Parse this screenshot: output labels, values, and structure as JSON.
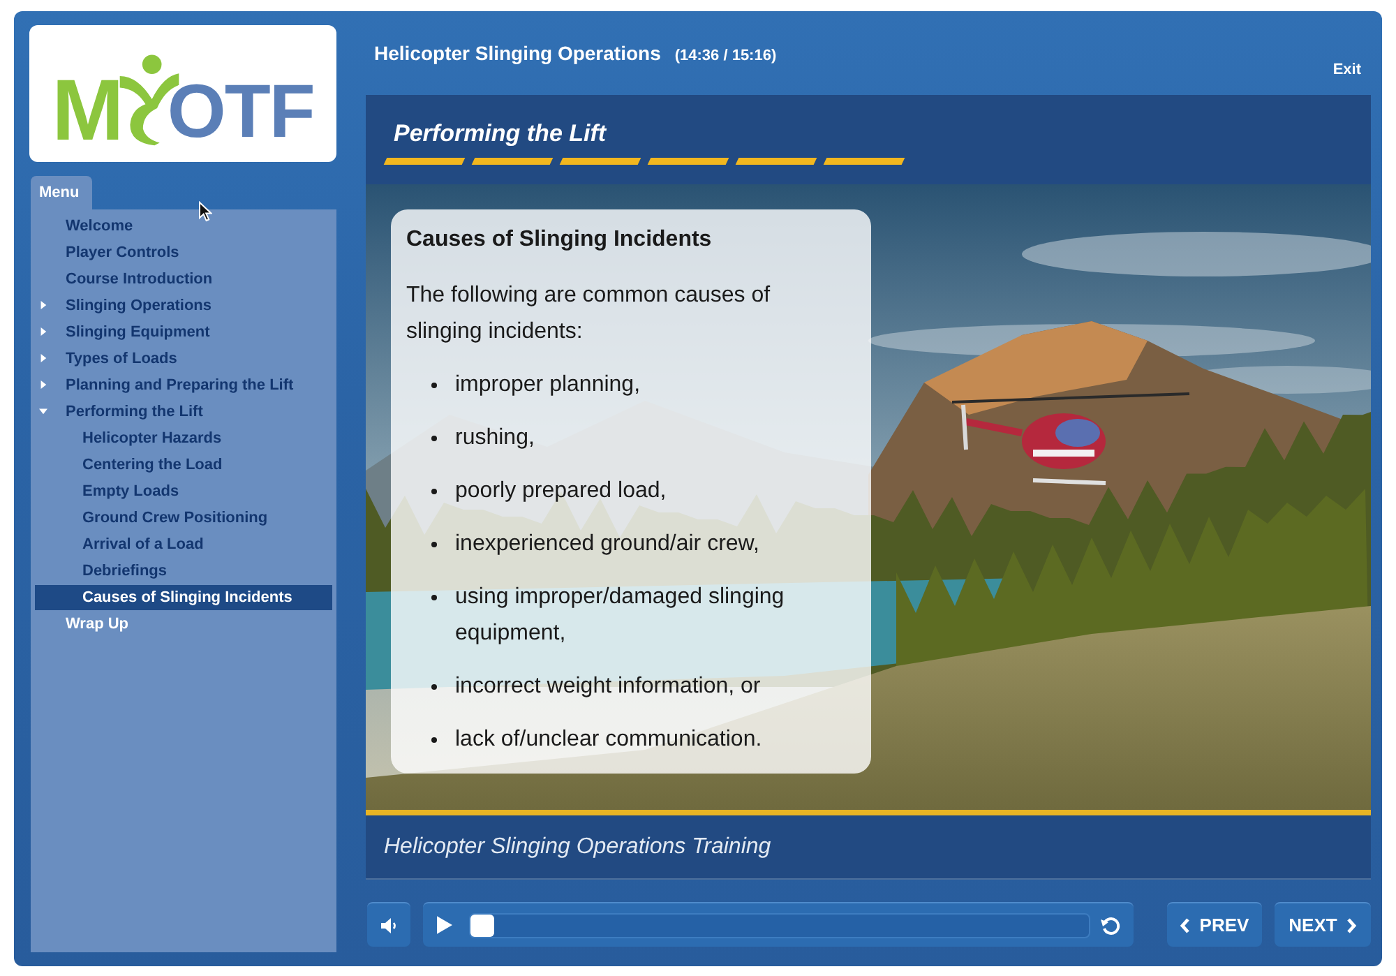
{
  "window": {
    "title": "Helicopter Slinging Operations",
    "elapsed": "(14:36 / 15:16)",
    "exit": "Exit"
  },
  "logo": {
    "lead": "M",
    "tail": "OTF"
  },
  "menu": {
    "tab": "Menu",
    "items": [
      {
        "label": "Welcome",
        "visited": true,
        "selected": false
      },
      {
        "label": "Player Controls",
        "visited": true,
        "selected": false
      },
      {
        "label": "Course Introduction",
        "visited": true,
        "selected": false
      },
      {
        "label": "Slinging Operations",
        "visited": true,
        "selected": false,
        "expanded": false
      },
      {
        "label": "Slinging Equipment",
        "visited": true,
        "selected": false,
        "expanded": false
      },
      {
        "label": "Types of Loads",
        "visited": true,
        "selected": false,
        "expanded": false
      },
      {
        "label": "Planning and Preparing the Lift",
        "visited": true,
        "selected": false,
        "expanded": false
      },
      {
        "label": "Performing the Lift",
        "visited": true,
        "selected": false,
        "expanded": true,
        "children": [
          {
            "label": "Helicopter Hazards",
            "visited": true,
            "selected": false
          },
          {
            "label": "Centering the Load",
            "visited": true,
            "selected": false
          },
          {
            "label": "Empty Loads",
            "visited": true,
            "selected": false
          },
          {
            "label": "Ground Crew Positioning",
            "visited": true,
            "selected": false
          },
          {
            "label": "Arrival of a Load",
            "visited": true,
            "selected": false
          },
          {
            "label": "Debriefings",
            "visited": true,
            "selected": false
          },
          {
            "label": "Causes of Slinging Incidents",
            "selected": true
          }
        ]
      },
      {
        "label": "Wrap Up",
        "visited": false,
        "selected": false
      }
    ]
  },
  "slide": {
    "heading": "Performing the Lift",
    "card": {
      "title": "Causes of Slinging Incidents",
      "intro": "The following are common causes of slinging incidents:",
      "bullets": [
        "improper planning,",
        "rushing,",
        "poorly prepared load,",
        "inexperienced ground/air crew,",
        "using improper/damaged slinging equipment,",
        "incorrect weight information, or",
        "lack of/unclear communication."
      ]
    },
    "caption": "Helicopter Slinging Operations Training"
  },
  "player": {
    "level": 0,
    "prev": "PREV",
    "next": "NEXT"
  }
}
